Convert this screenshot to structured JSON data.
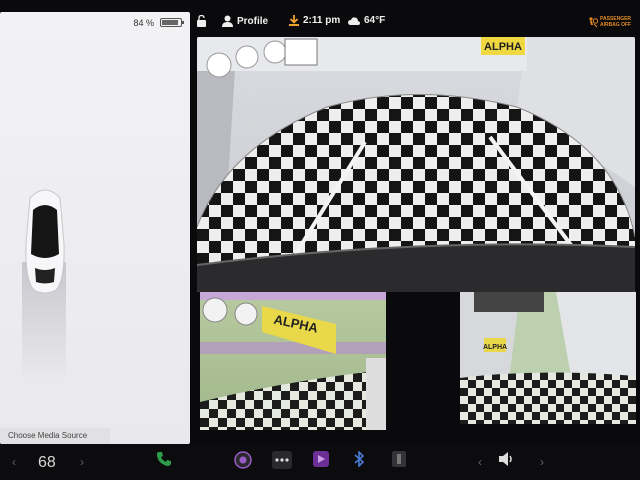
{
  "left_panel": {
    "battery_percent": "84 %",
    "media_source_label": "Choose Media Source"
  },
  "top_bar": {
    "profile_label": "Profile",
    "time": "2:11 pm",
    "temperature": "64°F",
    "airbag_status": "PASSENGER AIRBAG OFF"
  },
  "cameras": {
    "rear_banner_text": "ALPHA",
    "left_banner_text": "ALPHA",
    "right_banner_text": "ALPHA"
  },
  "taskbar": {
    "cabin_temperature": "68"
  },
  "icons": {
    "lock": "lock-icon",
    "profile": "person-icon",
    "download": "download-icon",
    "weather": "cloud-icon",
    "phone": "phone-icon",
    "camera": "camera-icon",
    "more": "dots-icon",
    "media": "media-icon",
    "bluetooth": "bluetooth-icon",
    "app": "app-icon",
    "volume": "volume-icon"
  },
  "colors": {
    "accent_orange": "#e38a23",
    "download_orange": "#f0a030",
    "phone_green": "#2e9d4a",
    "camera_purple": "#9a5cc8"
  }
}
